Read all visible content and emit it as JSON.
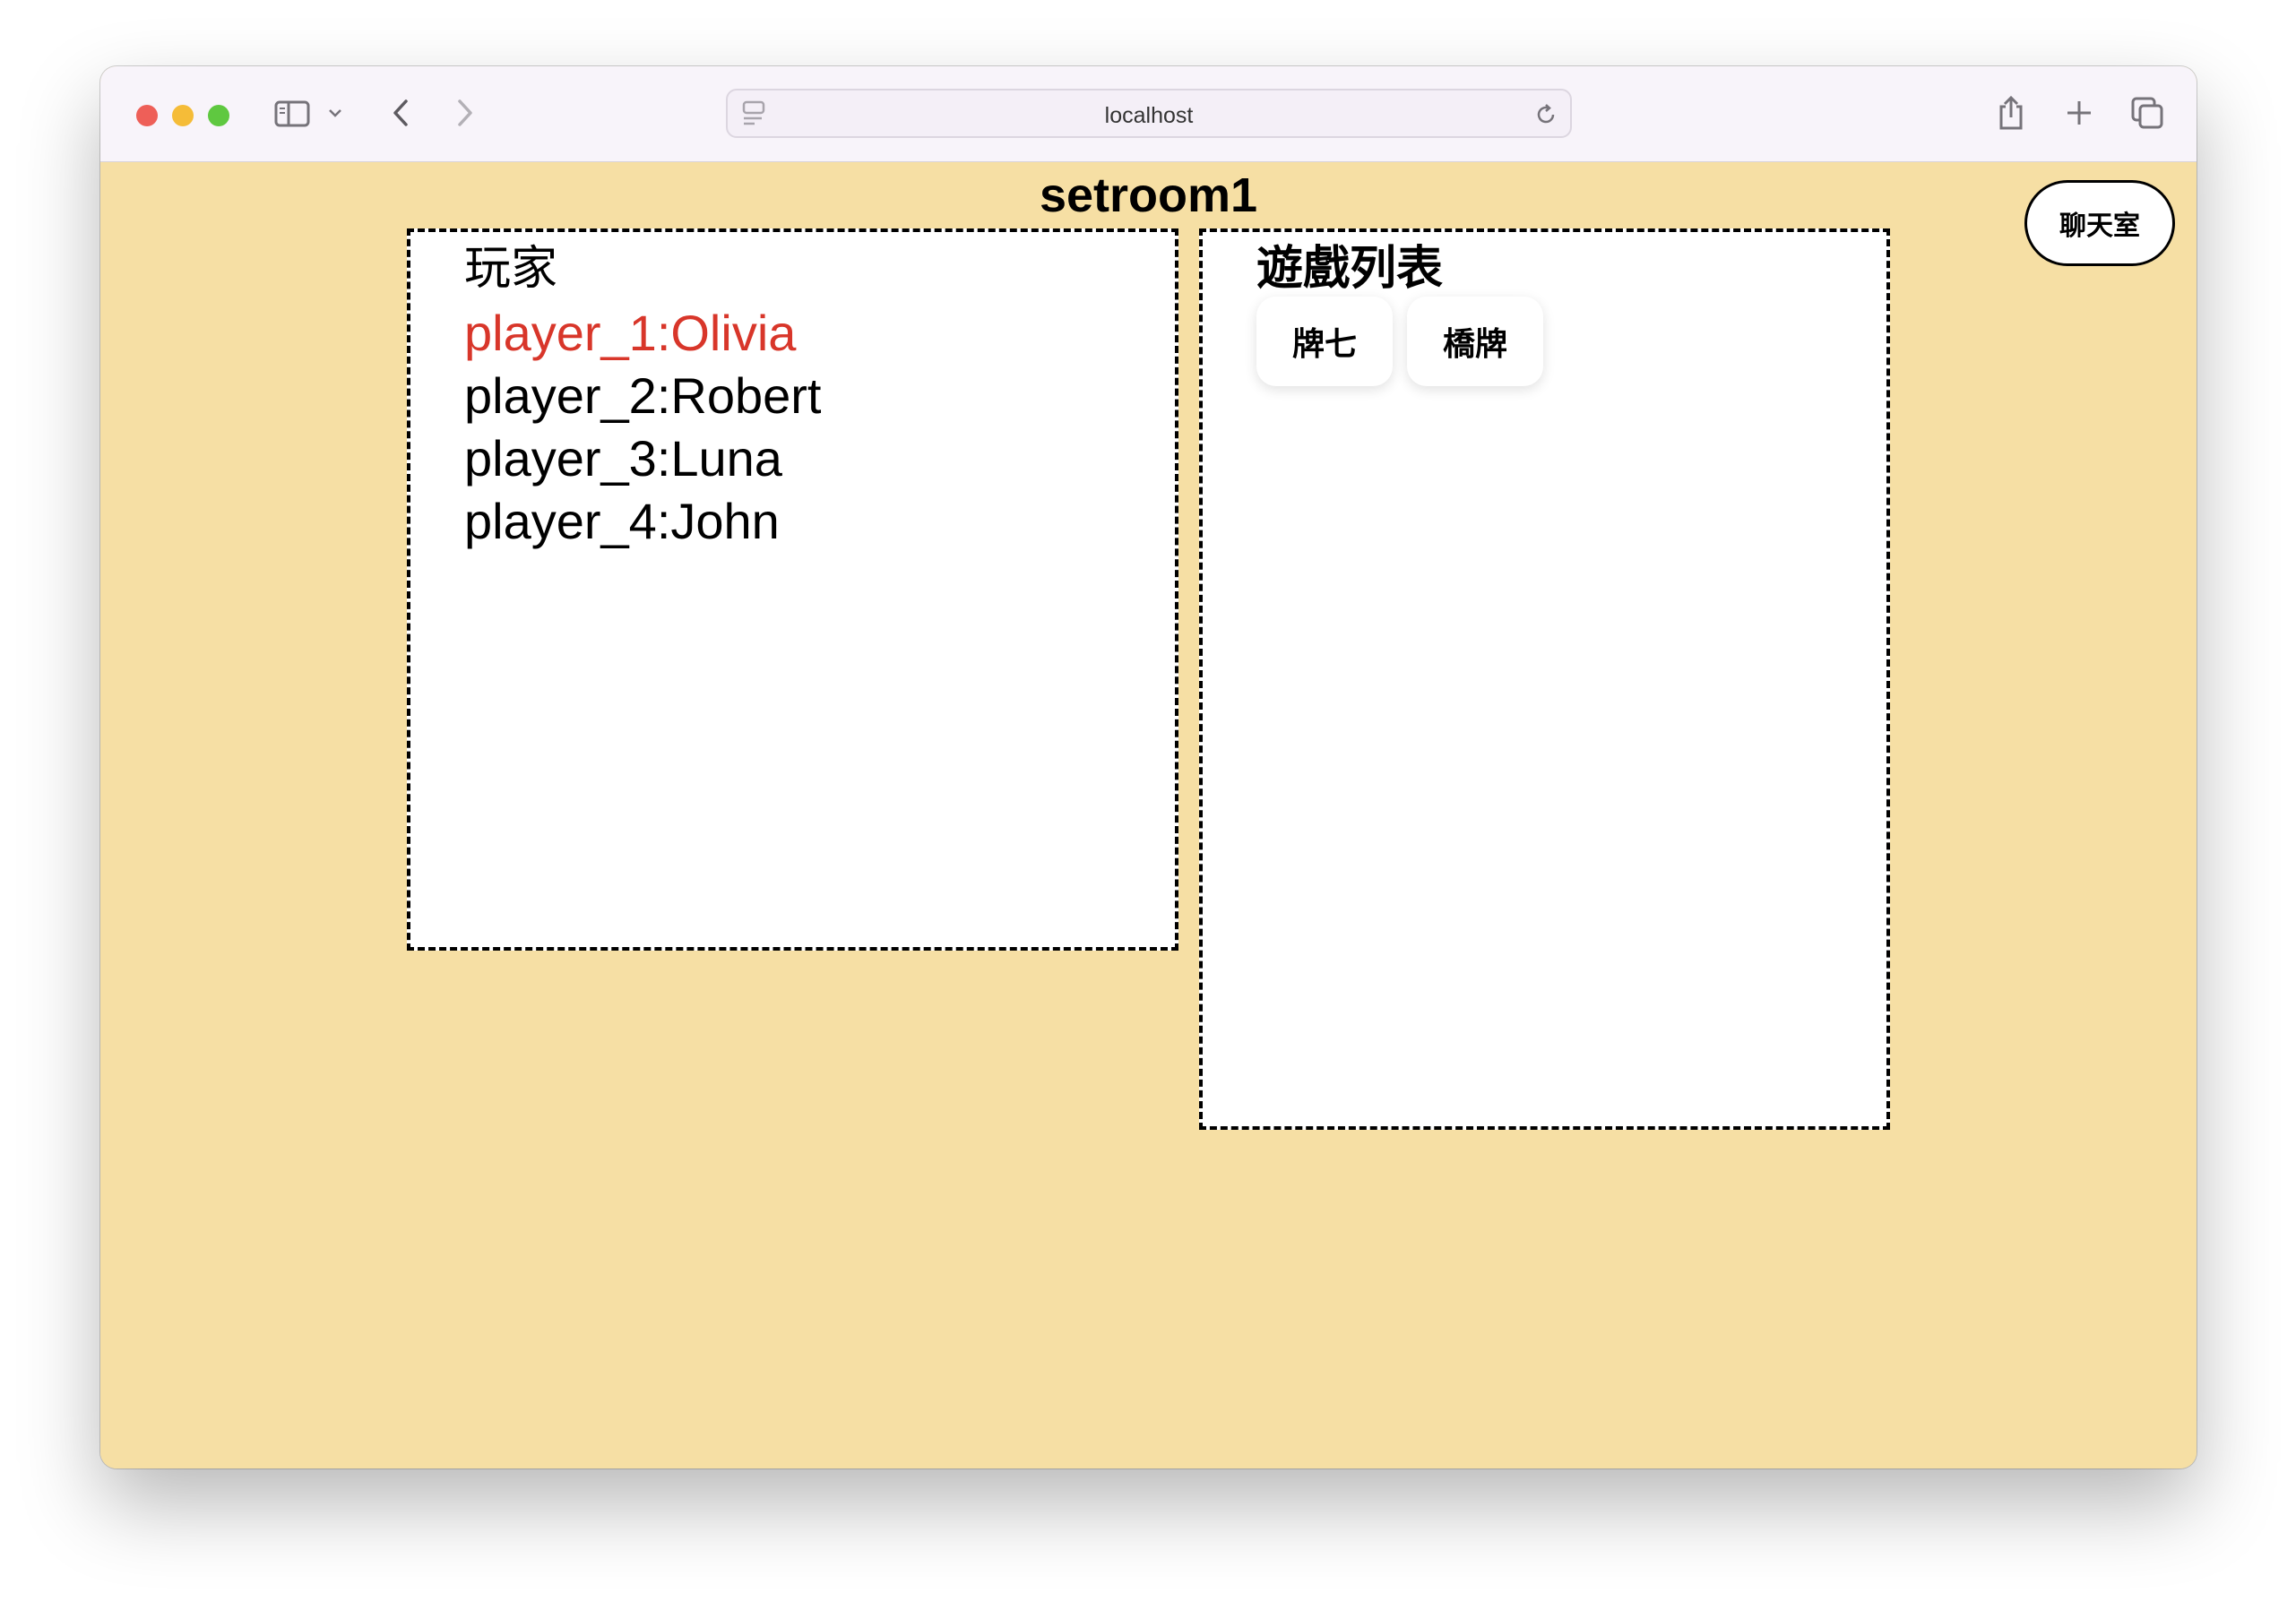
{
  "browser": {
    "url": "localhost",
    "traffic_lights": {
      "close": "#ee5f58",
      "minimize": "#f5bc38",
      "maximize": "#5fc840"
    },
    "icons": {
      "sidebar": "sidebar-icon",
      "chevron": "chevron-down-icon",
      "back": "back-arrow-icon",
      "forward": "forward-arrow-icon",
      "page": "page-icon",
      "reload": "reload-icon",
      "share": "share-icon",
      "new_tab": "plus-icon",
      "tabs": "tab-overview-icon"
    }
  },
  "page": {
    "background": "#f6dfa4",
    "title": "setroom1",
    "chat_button": "聊天室"
  },
  "players_panel": {
    "heading": "玩家",
    "active_color": "#d8362a",
    "players": [
      {
        "label": "player_1:Olivia",
        "active": true
      },
      {
        "label": "player_2:Robert",
        "active": false
      },
      {
        "label": "player_3:Luna",
        "active": false
      },
      {
        "label": "player_4:John",
        "active": false
      }
    ]
  },
  "games_panel": {
    "heading": "遊戲列表",
    "games": [
      "牌七",
      "橋牌"
    ]
  }
}
